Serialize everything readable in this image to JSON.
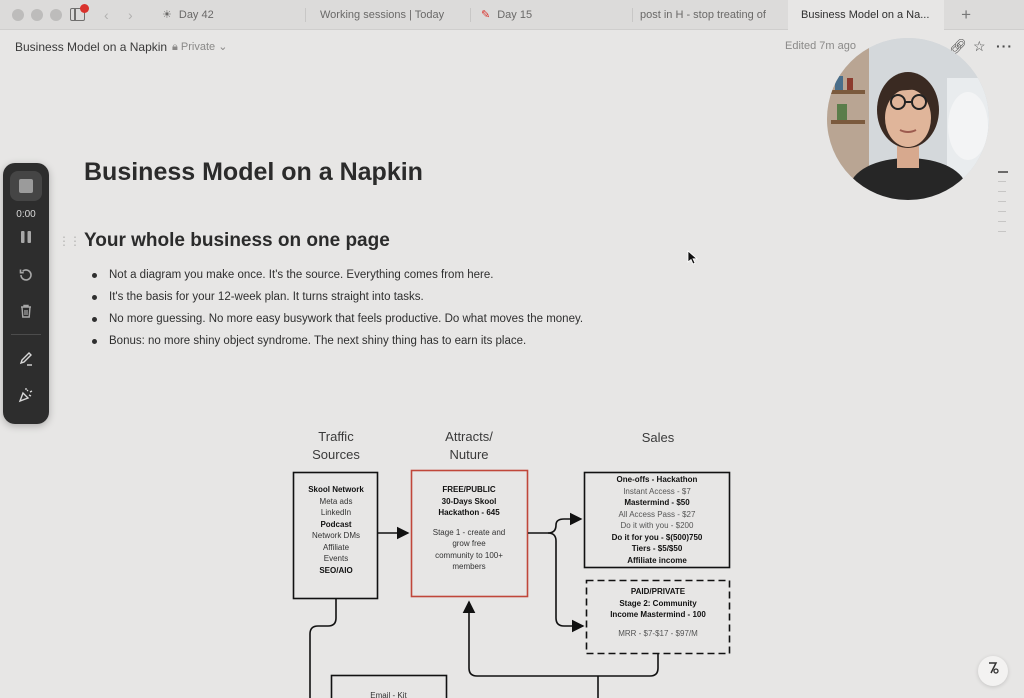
{
  "tabbar": {
    "tabs": [
      {
        "label": "Day 42",
        "icon": "sun-icon"
      },
      {
        "label": "Working sessions | Today",
        "icon": ""
      },
      {
        "label": "Day 15",
        "icon": "edit-icon"
      },
      {
        "label": "post in H - stop treating of",
        "icon": ""
      },
      {
        "label": "Business Model on a Na...",
        "icon": ""
      }
    ],
    "new_tab": "+"
  },
  "topnav": {
    "breadcrumb": "Business Model on a Napkin",
    "privacy": "Private",
    "edited": "Edited 7m ago"
  },
  "recorder": {
    "time": "0:00"
  },
  "document": {
    "title": "Business Model on a Napkin",
    "section_heading": "Your whole business on one page",
    "bullets": [
      "Not a diagram you make once. It's the source. Everything comes from here.",
      "It's the basis for your 12-week plan. It turns straight into tasks.",
      "No more guessing. No more easy busywork that feels productive. Do what moves the money.",
      "Bonus: no more shiny object syndrome. The next shiny thing has to earn its place."
    ]
  },
  "diagram": {
    "headers": {
      "traffic": [
        "Traffic",
        "Sources"
      ],
      "attracts": [
        "Attracts/",
        "Nuture"
      ],
      "sales": "Sales"
    },
    "traffic_box": [
      "Skool Network",
      "Meta ads",
      "LinkedIn",
      "Podcast",
      "Network DMs",
      "Affiliate",
      "Events",
      "SEO/AIO"
    ],
    "free_box": {
      "title": [
        "FREE/PUBLIC",
        "30-Days Skool",
        "Hackathon - 645"
      ],
      "desc": [
        "Stage 1 - create and",
        "grow free",
        "community to 100+",
        "members"
      ]
    },
    "sales_box": [
      "One-offs - Hackathon",
      "Instant Access - $7",
      "Mastermind - $50",
      "All Access Pass - $27",
      "Do it with you - $200",
      "Do it for you - $(500)750",
      "Tiers  - $5/$50",
      "Affiliate income"
    ],
    "paid_box": {
      "title": [
        "PAID/PRIVATE",
        "Stage 2:  Community",
        "Income Mastermind - 100"
      ],
      "mrr": "MRR - $7-$17 - $97/M"
    },
    "email_box": "Email - Kit",
    "accent_color": "#c0473a"
  }
}
